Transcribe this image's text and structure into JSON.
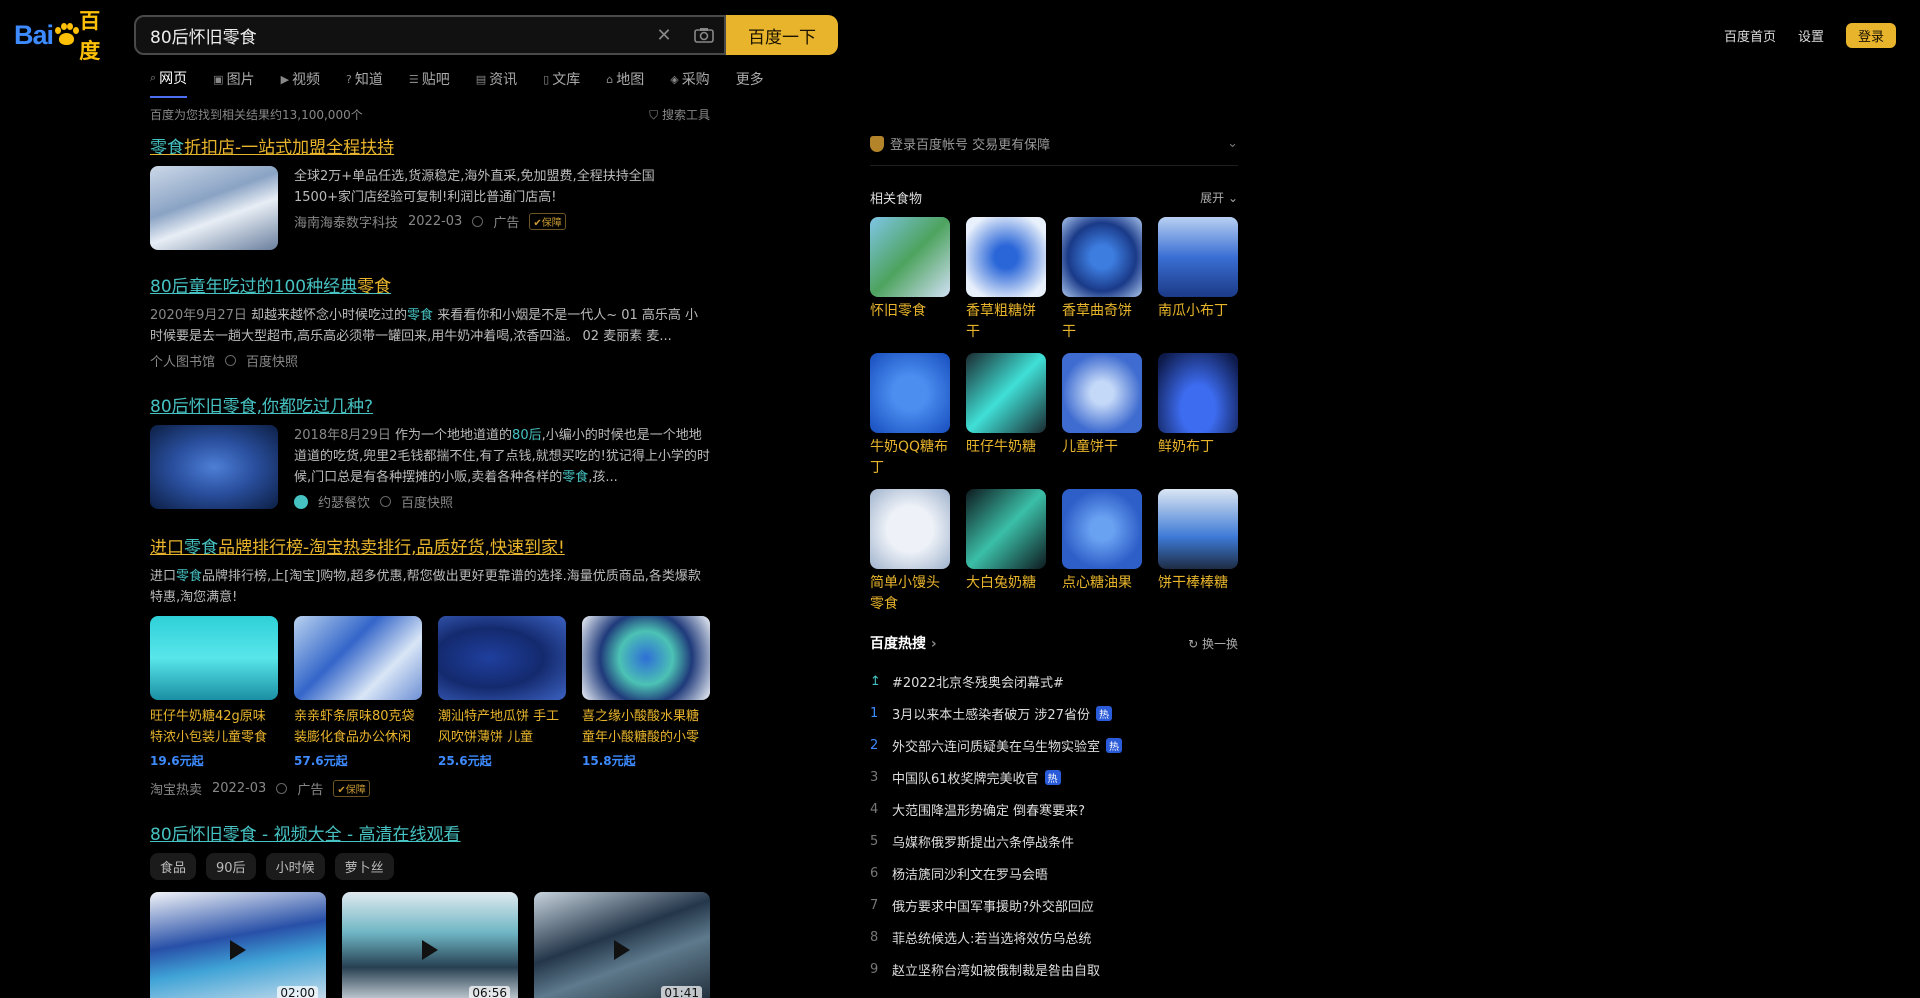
{
  "header": {
    "logo_text": "Bai",
    "logo_text2": "百度",
    "search_value": "80后怀旧零食",
    "search_button": "百度一下",
    "links": [
      "百度首页",
      "设置"
    ],
    "login": "登录"
  },
  "tabs": [
    "网页",
    "图片",
    "视频",
    "知道",
    "贴吧",
    "资讯",
    "文库",
    "地图",
    "采购",
    "更多"
  ],
  "result_count": "百度为您找到相关结果约13,100,000个",
  "search_tools": "搜索工具",
  "results": {
    "ad1": {
      "title_hl": "零食",
      "title_rest": "折扣店-一站式加盟全程扶持",
      "text": "全球2万+单品任选,货源稳定,海外直采,免加盟费,全程扶持全国1500+家门店经验可复制!利润比普通门店高!",
      "source": "海南海泰数字科技",
      "date": "2022-03",
      "ad": "广告",
      "safe": "保障"
    },
    "r2": {
      "title": "80后童年吃过的100种经典",
      "title_hl": "零食",
      "date": "2020年9月27日",
      "text_a": " 却越来越怀念小时候吃过的",
      "text_hl": "零食",
      "text_b": " 来看看你和小烟是不是一代人~ 01 高乐高 小时候要是去一趟大型超市,高乐高必须带一罐回来,用牛奶冲着喝,浓香四溢。 02 麦丽素 麦...",
      "source": "个人图书馆",
      "snapshot": "百度快照"
    },
    "r3": {
      "title": "80后怀旧零食,你都吃过几种?",
      "date": "2018年8月29日",
      "text_a": " 作为一个地地道道的",
      "text_hl": "80后",
      "text_b": ",小编小的时候也是一个地地道道的吃货,兜里2毛钱都揣不住,有了点钱,就想买吃的!犹记得上小学的时候,门口总是有各种摆摊的小贩,卖着各种各样的",
      "text_hl2": "零食",
      "text_c": ",孩...",
      "source": "约瑟餐饮",
      "snapshot": "百度快照"
    },
    "ad2": {
      "title_a": "进口",
      "title_hl": "零食",
      "title_b": "品牌排行榜-淘宝热卖排行,品质好货,快速到家!",
      "text_a": "进口",
      "text_hl": "零食",
      "text_b": "品牌排行榜,上[淘宝]购物,超多优惠,帮您做出更好更靠谱的选择.海量优质商品,各类爆款特惠,淘您满意!",
      "products": [
        {
          "name": "旺仔牛奶糖42g原味特浓小包装儿童零食",
          "price": "19.6元起"
        },
        {
          "name": "亲亲虾条原味80克袋装膨化食品办公休闲",
          "price": "57.6元起"
        },
        {
          "name": "潮汕特产地瓜饼 手工风吹饼薄饼 儿童",
          "price": "25.6元起"
        },
        {
          "name": "喜之缘小酸酸水果糖童年小酸糖酸的小零",
          "price": "15.8元起"
        }
      ],
      "source": "淘宝热卖",
      "date": "2022-03",
      "ad": "广告",
      "safe": "保障"
    },
    "video": {
      "title": "80后怀旧零食 - 视频大全 - 高清在线观看",
      "chips": [
        "食品",
        "90后",
        "小时候",
        "萝卜丝"
      ],
      "durations": [
        "02:00",
        "06:56",
        "01:41"
      ]
    }
  },
  "right": {
    "login_promo": "登录百度帐号 交易更有保障",
    "related_title": "相关食物",
    "expand": "展开",
    "foods": [
      "怀旧零食",
      "香草粗糖饼干",
      "香草曲奇饼干",
      "南瓜小布丁",
      "牛奶QQ糖布丁",
      "旺仔牛奶糖",
      "儿童饼干",
      "鲜奶布丁",
      "简单小馒头零食",
      "大白兔奶糖",
      "点心糖油果",
      "饼干棒棒糖"
    ],
    "hot_title": "百度热搜",
    "refresh": "换一换",
    "hot": [
      {
        "rank": "",
        "text": "#2022北京冬残奥会闭幕式#",
        "badge": ""
      },
      {
        "rank": "1",
        "text": "3月以来本土感染者破万 涉27省份",
        "badge": "热"
      },
      {
        "rank": "2",
        "text": "外交部六连问质疑美在乌生物实验室",
        "badge": "热"
      },
      {
        "rank": "3",
        "text": "中国队61枚奖牌完美收官",
        "badge": "热"
      },
      {
        "rank": "4",
        "text": "大范围降温形势确定 倒春寒要来?",
        "badge": ""
      },
      {
        "rank": "5",
        "text": "乌媒称俄罗斯提出六条停战条件",
        "badge": ""
      },
      {
        "rank": "6",
        "text": "杨洁篪同沙利文在罗马会晤",
        "badge": ""
      },
      {
        "rank": "7",
        "text": "俄方要求中国军事援助?外交部回应",
        "badge": ""
      },
      {
        "rank": "8",
        "text": "菲总统候选人:若当选将效仿乌总统",
        "badge": ""
      },
      {
        "rank": "9",
        "text": "赵立坚称台湾如被俄制裁是咎由自取",
        "badge": ""
      }
    ]
  },
  "colors": {
    "accent": "#e7b42c",
    "teal": "#46c2c2",
    "blue": "#3d8bff"
  }
}
